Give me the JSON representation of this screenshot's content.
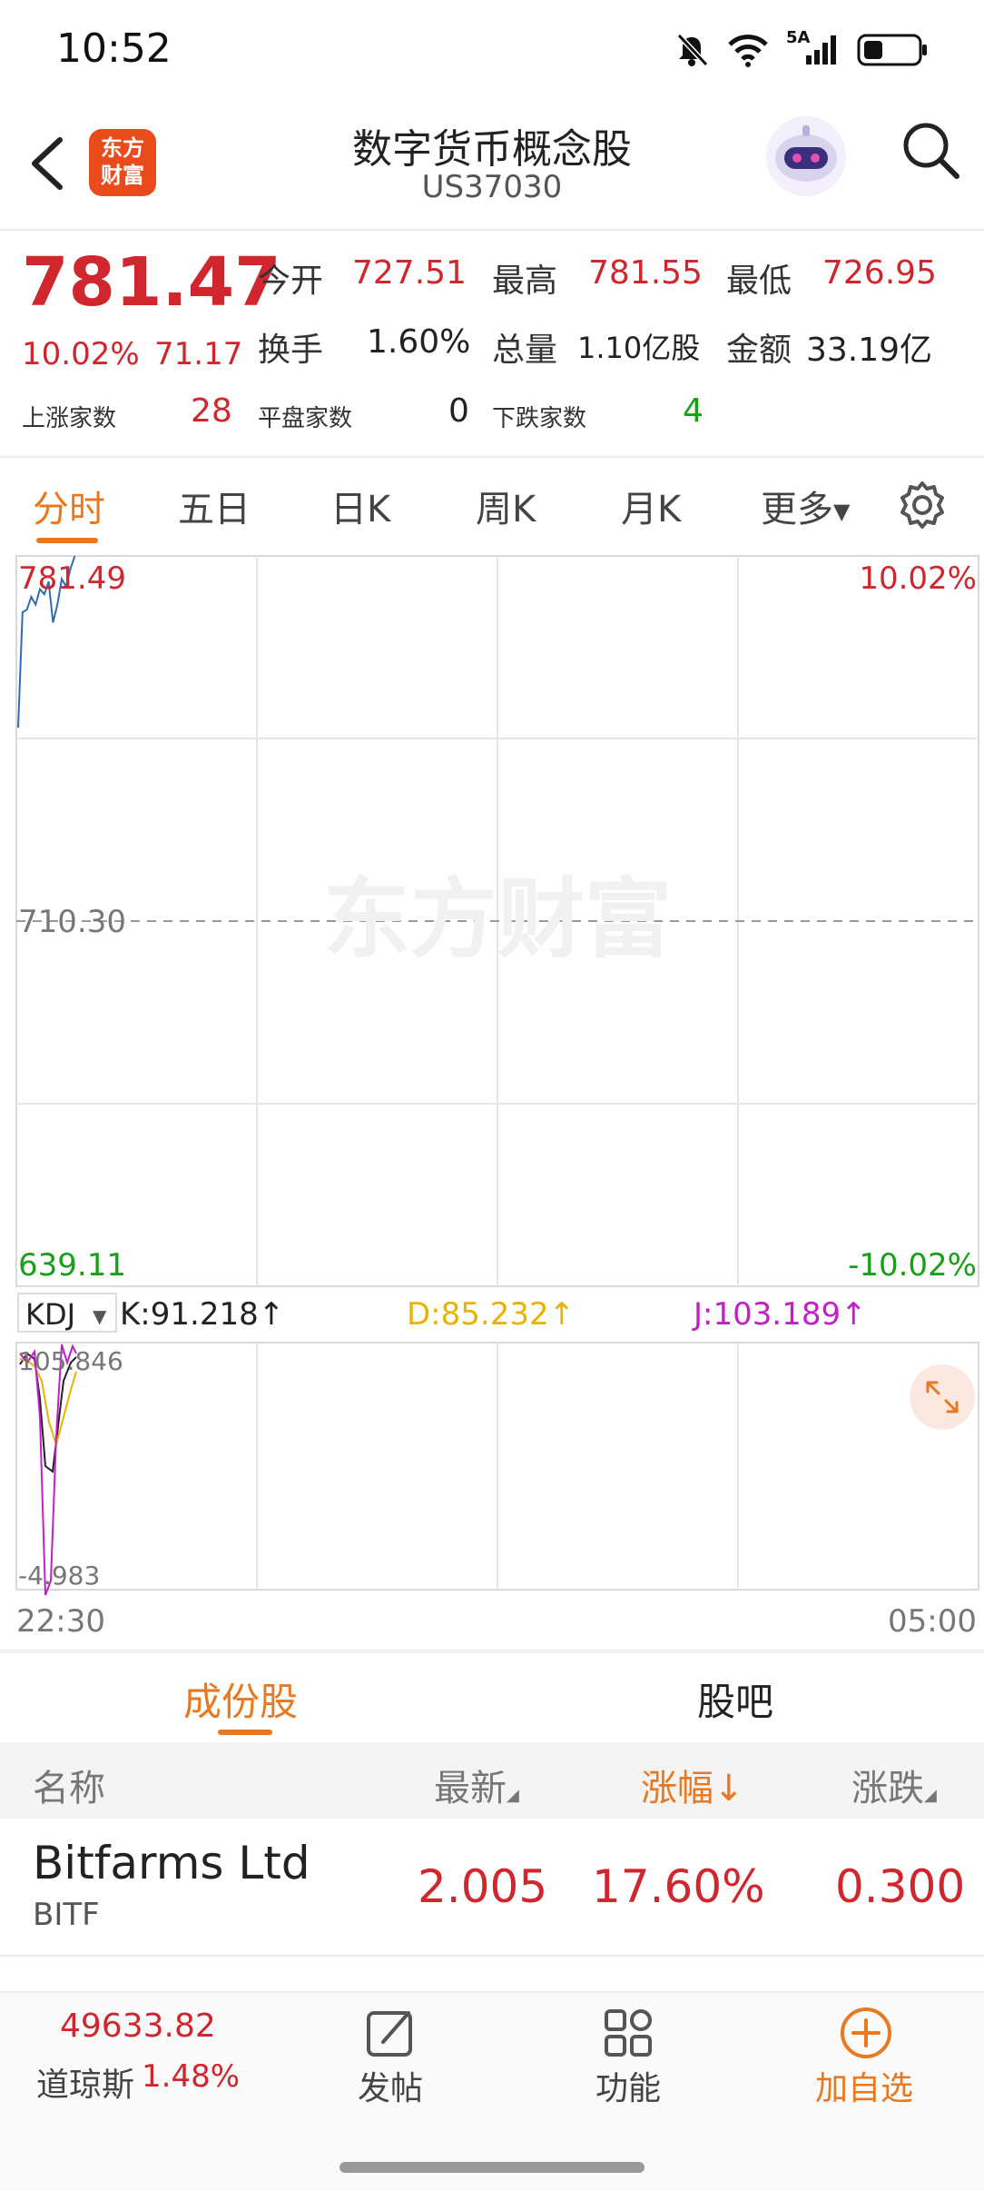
{
  "status": {
    "time": "10:52",
    "network": "5A"
  },
  "header": {
    "title": "数字货币概念股",
    "code": "US37030",
    "logo_text": "东方财富"
  },
  "quote": {
    "price": "781.47",
    "change_pct": "10.02%",
    "change": "71.17",
    "open_label": "今开",
    "open": "727.51",
    "high_label": "最高",
    "high": "781.55",
    "low_label": "最低",
    "low": "726.95",
    "turnover_label": "换手",
    "turnover": "1.60%",
    "volume_label": "总量",
    "volume": "1.10亿股",
    "amount_label": "金额",
    "amount": "33.19亿",
    "up_label": "上涨家数",
    "up": "28",
    "flat_label": "平盘家数",
    "flat": "0",
    "down_label": "下跌家数",
    "down": "4"
  },
  "tabs": [
    "分时",
    "五日",
    "日K",
    "周K",
    "月K",
    "更多"
  ],
  "chart": {
    "watermark": "东方财富",
    "top_price": "781.49",
    "mid_price": "710.30",
    "bottom_price": "639.11",
    "top_pct": "10.02%",
    "bottom_pct": "-10.02%",
    "kdj_select": "KDJ",
    "k": "K:91.218↑",
    "d": "D:85.232↑",
    "j": "J:103.189↑",
    "kdj_top": "105.846",
    "kdj_bottom": "-4.983",
    "time_start": "22:30",
    "time_end": "05:00",
    "colors": {
      "price_line": "#2f6db3",
      "k": "#222222",
      "d": "#e8b400",
      "j": "#c21fc9"
    }
  },
  "chart_data": {
    "type": "line",
    "series": [
      {
        "name": "price",
        "values": [
          748.0,
          770.5,
          771.0,
          773.5,
          772.0,
          775.0,
          774.0,
          776.5,
          768.5,
          772.0,
          777.0,
          775.5,
          779.0,
          781.47
        ]
      }
    ],
    "ylim": [
      639.11,
      781.49
    ],
    "x_start": "22:30",
    "x_end": "05:00"
  },
  "subtabs": {
    "constituents": "成份股",
    "forum": "股吧"
  },
  "list_header": {
    "name": "名称",
    "latest": "最新",
    "pct": "涨幅↓",
    "change": "涨跌"
  },
  "rows": [
    {
      "name": "Bitfarms Ltd",
      "code": "BITF",
      "latest": "2.005",
      "pct": "17.60%",
      "change": "0.300"
    }
  ],
  "bottom_nav": {
    "index_value": "49633.82",
    "index_name": "道琼斯",
    "index_pct": "1.48%",
    "post": "发帖",
    "functions": "功能",
    "add": "加自选"
  }
}
